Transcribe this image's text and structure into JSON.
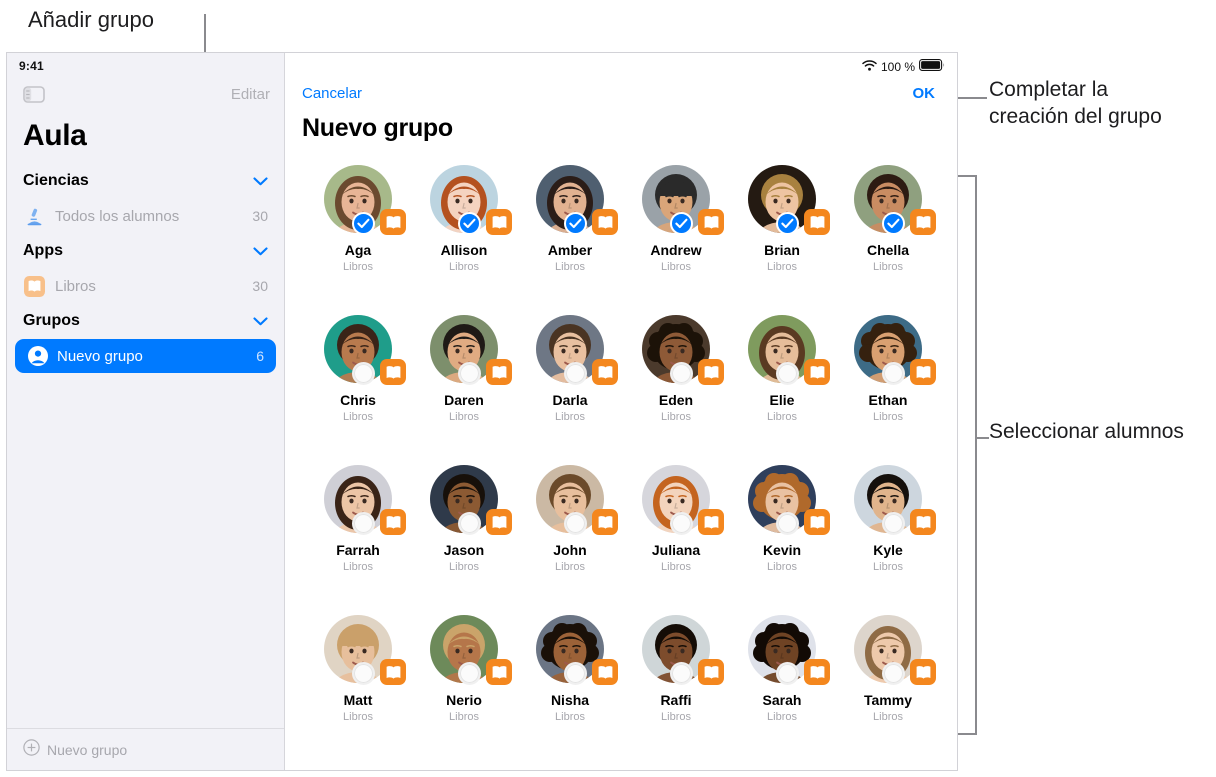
{
  "annotations": {
    "add_group": "Añadir grupo",
    "complete_creation": "Completar la creación del grupo",
    "select_students": "Seleccionar alumnos"
  },
  "status_bar": {
    "time": "9:41",
    "battery_percent": "100 %",
    "wifi_icon": "wifi-icon",
    "battery_icon": "battery-full-icon"
  },
  "sidebar": {
    "toggle_icon": "sidebar-toggle-icon",
    "edit_label": "Editar",
    "title": "Aula",
    "sections": [
      {
        "title": "Ciencias",
        "chevron_icon": "chevron-down-icon",
        "rows": [
          {
            "icon": "microscope-icon",
            "label": "Todos los alumnos",
            "count": "30",
            "selected": false
          }
        ]
      },
      {
        "title": "Apps",
        "chevron_icon": "chevron-down-icon",
        "rows": [
          {
            "icon": "books-app-icon",
            "label": "Libros",
            "count": "30",
            "selected": false
          }
        ]
      },
      {
        "title": "Grupos",
        "chevron_icon": "chevron-down-icon",
        "rows": [
          {
            "icon": "person-circle-icon",
            "label": "Nuevo grupo",
            "count": "6",
            "selected": true
          }
        ]
      }
    ],
    "footer": {
      "icon": "plus-circle-icon",
      "label": "Nuevo grupo"
    }
  },
  "main": {
    "cancel_label": "Cancelar",
    "ok_label": "OK",
    "title": "Nuevo grupo",
    "app_label": "Libros",
    "app_badge_icon": "books-app-icon",
    "check_icon": "checkmark-icon",
    "students": [
      {
        "name": "Aga",
        "app": "Libros",
        "selected": true,
        "skin": "#e8b596",
        "hair": "#6b4a2f",
        "bg": "#a7b98a",
        "hairstyle": "long"
      },
      {
        "name": "Allison",
        "app": "Libros",
        "selected": true,
        "skin": "#f4d3c0",
        "hair": "#b4511f",
        "bg": "#bcd4e0",
        "hairstyle": "long"
      },
      {
        "name": "Amber",
        "app": "Libros",
        "selected": true,
        "skin": "#e2b291",
        "hair": "#2b1d18",
        "bg": "#4f5f70",
        "hairstyle": "long"
      },
      {
        "name": "Andrew",
        "app": "Libros",
        "selected": true,
        "skin": "#d9a579",
        "hair": "#2a2a2a",
        "bg": "#9aa2a8",
        "hairstyle": "hat"
      },
      {
        "name": "Brian",
        "app": "Libros",
        "selected": true,
        "skin": "#eec4a2",
        "hair": "#a8813f",
        "bg": "#241a12",
        "hairstyle": "short"
      },
      {
        "name": "Chella",
        "app": "Libros",
        "selected": true,
        "skin": "#c98c62",
        "hair": "#2d1b12",
        "bg": "#8fa07f",
        "hairstyle": "short"
      },
      {
        "name": "Chris",
        "app": "Libros",
        "selected": false,
        "skin": "#b87a4e",
        "hair": "#3a2418",
        "bg": "#1f9d8a",
        "hairstyle": "short"
      },
      {
        "name": "Daren",
        "app": "Libros",
        "selected": false,
        "skin": "#e0ab82",
        "hair": "#1f1a16",
        "bg": "#7d8f6c",
        "hairstyle": "short"
      },
      {
        "name": "Darla",
        "app": "Libros",
        "selected": false,
        "skin": "#e9c0a0",
        "hair": "#4a3423",
        "bg": "#6e7785",
        "hairstyle": "short"
      },
      {
        "name": "Eden",
        "app": "Libros",
        "selected": false,
        "skin": "#8e5a37",
        "hair": "#1c1208",
        "bg": "#4b3a2c",
        "hairstyle": "curly"
      },
      {
        "name": "Elie",
        "app": "Libros",
        "selected": false,
        "skin": "#e6bd9a",
        "hair": "#5a3a22",
        "bg": "#7f9b5e",
        "hairstyle": "long"
      },
      {
        "name": "Ethan",
        "app": "Libros",
        "selected": false,
        "skin": "#d9a071",
        "hair": "#35210f",
        "bg": "#3d6b86",
        "hairstyle": "curly"
      },
      {
        "name": "Farrah",
        "app": "Libros",
        "selected": false,
        "skin": "#ecc5a6",
        "hair": "#3a2417",
        "bg": "#cfcfd6",
        "hairstyle": "long"
      },
      {
        "name": "Jason",
        "app": "Libros",
        "selected": false,
        "skin": "#8c5a33",
        "hair": "#17100a",
        "bg": "#2f3a4a",
        "hairstyle": "short"
      },
      {
        "name": "John",
        "app": "Libros",
        "selected": false,
        "skin": "#e8bf9d",
        "hair": "#6b4a2a",
        "bg": "#cbb9a4",
        "hairstyle": "short"
      },
      {
        "name": "Juliana",
        "app": "Libros",
        "selected": false,
        "skin": "#f3d4bd",
        "hair": "#c4641f",
        "bg": "#d6d6dc",
        "hairstyle": "long"
      },
      {
        "name": "Kevin",
        "app": "Libros",
        "selected": false,
        "skin": "#e9c2a2",
        "hair": "#b0692b",
        "bg": "#2f3f5c",
        "hairstyle": "curly"
      },
      {
        "name": "Kyle",
        "app": "Libros",
        "selected": false,
        "skin": "#e0b48c",
        "hair": "#15100c",
        "bg": "#cdd6de",
        "hairstyle": "short"
      },
      {
        "name": "Matt",
        "app": "Libros",
        "selected": false,
        "skin": "#e7bf9c",
        "hair": "#caa06a",
        "bg": "#e0d4c4",
        "hairstyle": "hat"
      },
      {
        "name": "Nerio",
        "app": "Libros",
        "selected": false,
        "skin": "#b5764a",
        "hair": "#caa46a",
        "bg": "#6d8a5a",
        "hairstyle": "short"
      },
      {
        "name": "Nisha",
        "app": "Libros",
        "selected": false,
        "skin": "#9c6238",
        "hair": "#1a1008",
        "bg": "#6b7585",
        "hairstyle": "curly"
      },
      {
        "name": "Raffi",
        "app": "Libros",
        "selected": false,
        "skin": "#7d4c2c",
        "hair": "#140c06",
        "bg": "#cfd6d8",
        "hairstyle": "short"
      },
      {
        "name": "Sarah",
        "app": "Libros",
        "selected": false,
        "skin": "#6f4324",
        "hair": "#120a05",
        "bg": "#dfe2ea",
        "hairstyle": "curly"
      },
      {
        "name": "Tammy",
        "app": "Libros",
        "selected": false,
        "skin": "#eec9ab",
        "hair": "#8f6b45",
        "bg": "#ddd5cc",
        "hairstyle": "long"
      }
    ]
  },
  "colors": {
    "accent_blue": "#007aff",
    "books_orange": "#f4871e",
    "sidebar_bg": "#f2f2f7",
    "muted_text": "#a7a7ad",
    "leader_gray": "#8a8a8e"
  }
}
